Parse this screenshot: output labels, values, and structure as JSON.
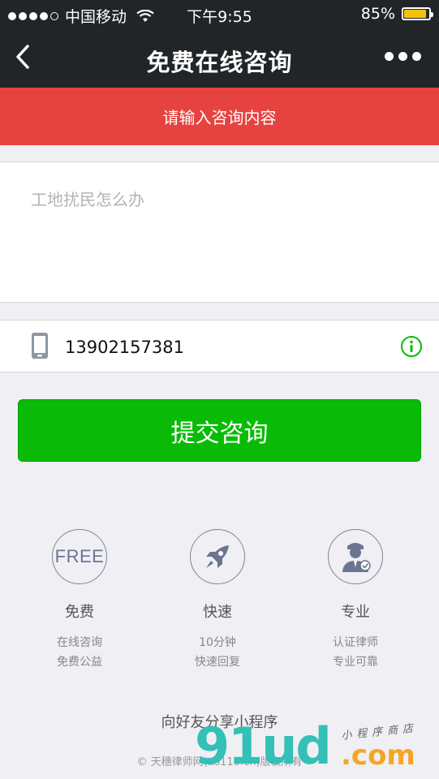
{
  "status_bar": {
    "carrier": "中国移动",
    "time": "下午9:55",
    "battery_percent": "85%",
    "battery_level": 0.85,
    "battery_color": "#f4c20d"
  },
  "nav": {
    "title": "免费在线咨询",
    "back_icon": "chevron-left-icon",
    "more_icon": "more-dots-icon"
  },
  "banner": {
    "text": "请输入咨询内容",
    "color": "#e64340"
  },
  "consult": {
    "placeholder": "工地扰民怎么办",
    "value": ""
  },
  "phone": {
    "value": "13902157381",
    "icon": "mobile-phone-icon",
    "info_icon": "info-icon"
  },
  "submit": {
    "label": "提交咨询",
    "color": "#09bb07"
  },
  "features": [
    {
      "icon": "free-badge-icon",
      "icon_text": "FREE",
      "title": "免费",
      "line1": "在线咨询",
      "line2": "免费公益"
    },
    {
      "icon": "rocket-icon",
      "title": "快速",
      "line1": "10分钟",
      "line2": "快速回复"
    },
    {
      "icon": "lawyer-icon",
      "title": "专业",
      "line1": "认证律师",
      "line2": "专业可靠"
    }
  ],
  "footer": {
    "share": "向好友分享小程序",
    "copyright": "© 天穗律师网(tls110.cn)版权所有"
  },
  "watermark": {
    "big": "91ud",
    "com": ".com",
    "small": "小程序商店"
  }
}
